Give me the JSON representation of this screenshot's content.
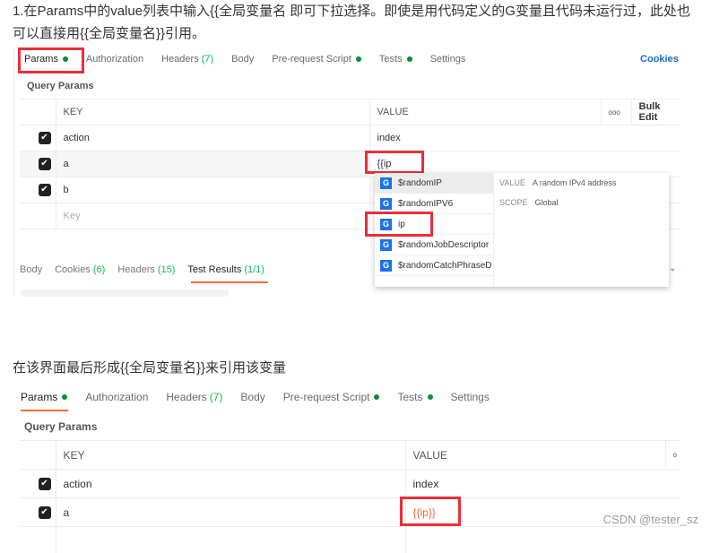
{
  "paragraph1": "1.在Params中的value列表中输入{{全局变量名 即可下拉选择。即使是用代码定义的G变量且代码未运行过，此处也可以直接用{{全局变量名}}引用。",
  "paragraph2": "在该界面最后形成{{全局变量名}}来引用该变量",
  "tabs": {
    "params": "Params",
    "authorization": "Authorization",
    "headers": "Headers",
    "headers_count": "(7)",
    "body": "Body",
    "prerequest": "Pre-request Script",
    "tests": "Tests",
    "settings": "Settings",
    "cookies": "Cookies"
  },
  "query_params_title": "Query Params",
  "table": {
    "key_header": "KEY",
    "value_header": "VALUE",
    "more_icon": "ooo",
    "bulk_edit": "Bulk Edit",
    "rows": [
      {
        "key": "action",
        "value": "index"
      },
      {
        "key": "a",
        "value": "{{ip"
      },
      {
        "key": "b",
        "value": ""
      }
    ],
    "key_placeholder": "Key"
  },
  "dropdown": {
    "items": [
      "$randomIP",
      "$randomIPV6",
      "ip",
      "$randomJobDescriptor",
      "$randomCatchPhraseD"
    ],
    "value_label": "VALUE",
    "value_text": "A random IPv4 address",
    "scope_label": "SCOPE",
    "scope_text": "Global"
  },
  "response_tabs": {
    "body": "Body",
    "cookies": "Cookies",
    "cookies_count": "(6)",
    "headers": "Headers",
    "headers_count": "(15)",
    "test_results": "Test Results",
    "test_results_count": "(1/1)"
  },
  "table2": {
    "rows": [
      {
        "key": "action",
        "value": "index"
      },
      {
        "key": "a",
        "value": "{{ip}}"
      }
    ]
  },
  "watermark": "CSDN @tester_sz"
}
